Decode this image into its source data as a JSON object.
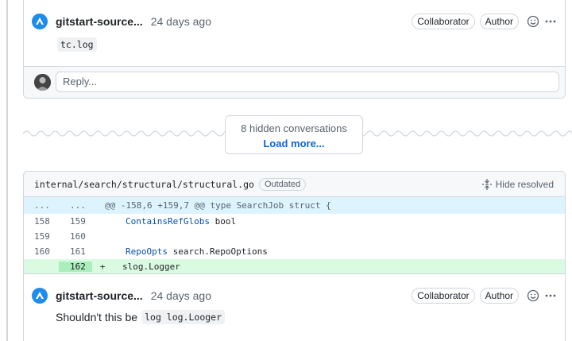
{
  "comment1": {
    "author": "gitstart-source...",
    "time": "24 days ago",
    "badge_collaborator": "Collaborator",
    "badge_author": "Author",
    "body_code": "tc.log"
  },
  "reply": {
    "placeholder": "Reply..."
  },
  "hidden": {
    "count_text": "8 hidden conversations",
    "load_more": "Load more..."
  },
  "file": {
    "path": "internal/search/structural/structural.go",
    "badge": "Outdated",
    "hide_resolved": "Hide resolved"
  },
  "diff": {
    "hunk": {
      "old": "...",
      "new": "...",
      "text": "@@ -158,6 +159,7 @@ type SearchJob struct {"
    },
    "rows": [
      {
        "old": "158",
        "new": "159",
        "sign": "",
        "kw": "ContainsRefGlobs",
        "rest": " bool"
      },
      {
        "old": "159",
        "new": "160",
        "sign": "",
        "kw": "",
        "rest": ""
      },
      {
        "old": "160",
        "new": "161",
        "sign": "",
        "kw": "RepoOpts",
        "rest": " search.RepoOptions"
      },
      {
        "old": "",
        "new": "162",
        "sign": "+",
        "kw": "",
        "rest": "slog.Logger"
      }
    ]
  },
  "comment2": {
    "author": "gitstart-source...",
    "time": "24 days ago",
    "badge_collaborator": "Collaborator",
    "badge_author": "Author",
    "text": "Shouldn't this be",
    "code": "log log.Looger"
  }
}
